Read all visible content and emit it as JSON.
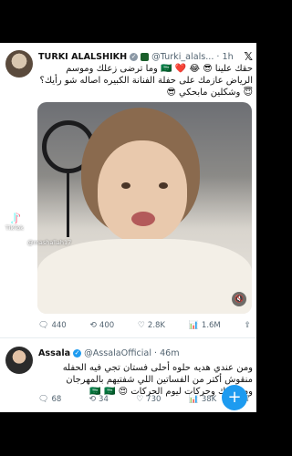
{
  "tweets": [
    {
      "name": "TURKI ALALSHIKH",
      "handle": "@Turki_alals...",
      "time": "· 1h",
      "text": "حقك علينا 😎 😂 ❤️ 🇸🇦 وما ترضى زعلك وموسم الرياض عازمك على حفلة الفنانة الكبيره اصاله شو رأيك؟ 😇 وشكلين مابحكي 😎",
      "stats": {
        "replies": "440",
        "retweets": "400",
        "likes": "2.8K",
        "views": "1.6M"
      }
    },
    {
      "name": "Assala",
      "handle": "@AssalaOfficial",
      "time": "· 46m",
      "text": "ومن عندي هديه حلوه أحلى فستان تجي فيه الحفله منقوش أكتر من الفساتين اللي شفتيهم بالمهرجان ومشكوك وحركات ليوم الحركات 😍 🇸🇦 🇸🇦",
      "stats": {
        "replies": "68",
        "retweets": "34",
        "likes": "730",
        "views": "38K"
      }
    }
  ],
  "brand": {
    "x_logo": "𝕏"
  },
  "watermark": {
    "app": "TikTok",
    "user": "@mashallah17"
  },
  "colors": {
    "link_blue": "#1d9bf0",
    "muted": "#536471"
  },
  "icons": {
    "reply": "🗨",
    "retweet": "⟲",
    "like": "♡",
    "views": "📊",
    "share": "⇪",
    "mute": "🔇",
    "fab": "+"
  }
}
